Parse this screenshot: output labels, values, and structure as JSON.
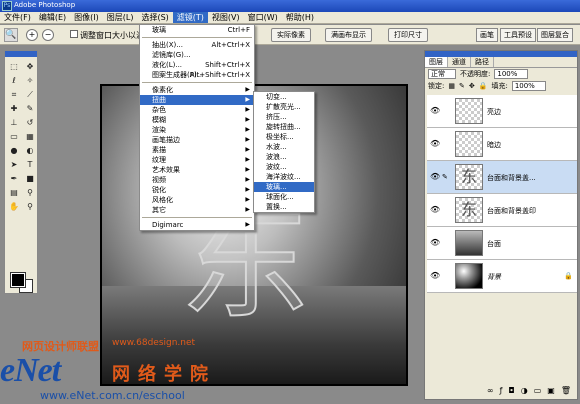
{
  "window": {
    "title": "Adobe Photoshop"
  },
  "menubar": {
    "items": [
      "文件(F)",
      "编辑(E)",
      "图像(I)",
      "图层(L)",
      "选择(S)",
      "滤镜(T)",
      "视图(V)",
      "窗口(W)",
      "帮助(H)"
    ],
    "active": "滤镜(T)"
  },
  "options": {
    "checkbox_label": "调整窗口大小以满屏",
    "buttons": [
      "实际像素",
      "满画布显示",
      "打印尺寸"
    ],
    "right_tabs": [
      "画笔",
      "工具预设",
      "图层复合"
    ]
  },
  "filter_menu": {
    "items": [
      {
        "label": "玻璃",
        "shortcut": "Ctrl+F"
      },
      {
        "sep": true
      },
      {
        "label": "抽出(X)...",
        "shortcut": "Alt+Ctrl+X"
      },
      {
        "label": "滤镜库(G)..."
      },
      {
        "label": "液化(L)...",
        "shortcut": "Shift+Ctrl+X"
      },
      {
        "label": "图案生成器(P)...",
        "shortcut": "Alt+Shift+Ctrl+X"
      },
      {
        "sep": true
      },
      {
        "label": "像素化",
        "submenu": true
      },
      {
        "label": "扭曲",
        "submenu": true,
        "highlight": true
      },
      {
        "label": "杂色",
        "submenu": true
      },
      {
        "label": "模糊",
        "submenu": true
      },
      {
        "label": "渲染",
        "submenu": true
      },
      {
        "label": "画笔描边",
        "submenu": true
      },
      {
        "label": "素描",
        "submenu": true
      },
      {
        "label": "纹理",
        "submenu": true
      },
      {
        "label": "艺术效果",
        "submenu": true
      },
      {
        "label": "视频",
        "submenu": true
      },
      {
        "label": "锐化",
        "submenu": true
      },
      {
        "label": "风格化",
        "submenu": true
      },
      {
        "label": "其它",
        "submenu": true
      },
      {
        "sep": true
      },
      {
        "label": "Digimarc",
        "submenu": true
      }
    ]
  },
  "distort_submenu": {
    "items": [
      {
        "label": "切变..."
      },
      {
        "label": "扩散亮光..."
      },
      {
        "label": "挤压..."
      },
      {
        "label": "旋转扭曲..."
      },
      {
        "label": "极坐标..."
      },
      {
        "label": "水波..."
      },
      {
        "label": "波浪..."
      },
      {
        "label": "波纹..."
      },
      {
        "label": "海洋波纹..."
      },
      {
        "label": "玻璃...",
        "highlight": true
      },
      {
        "label": "球面化..."
      },
      {
        "label": "置换..."
      }
    ]
  },
  "layers_panel": {
    "tabs": [
      "图层",
      "通道",
      "路径"
    ],
    "blend_mode": "正常",
    "opacity_label": "不透明度:",
    "opacity_value": "100%",
    "lock_label": "锁定:",
    "fill_label": "填充:",
    "fill_value": "100%",
    "layers": [
      {
        "name": "亮边",
        "thumb": "checker"
      },
      {
        "name": "暗边",
        "thumb": "checker"
      },
      {
        "name": "台面和背景盖...",
        "thumb": "glyph",
        "selected": true
      },
      {
        "name": "台面和背景盖印",
        "thumb": "glyph"
      },
      {
        "name": "台面",
        "thumb": "floor"
      },
      {
        "name": "背景",
        "thumb": "dark",
        "locked": true
      }
    ],
    "thumb_glyph": "东"
  },
  "canvas": {
    "glyph": "东"
  },
  "watermark": {
    "line1": "网页设计师联盟",
    "line2": "www.68design.net",
    "logo": "eNet",
    "line3": "网络学院",
    "line4": "www.eNet.com.cn/eschool"
  }
}
